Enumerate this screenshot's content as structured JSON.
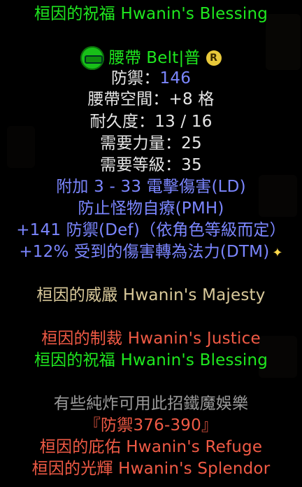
{
  "set_item_name": "桓因的祝福 Hwanin's Blessing",
  "item_type": {
    "label": "腰帶 Belt|普",
    "icon": "belt-icon",
    "rarity_badge": "R"
  },
  "stats": {
    "defense_label": "防禦：",
    "defense_value": "146",
    "belt_slots": "腰帶空間：+8 格",
    "durability": "耐久度：13 / 16",
    "req_str": "需要力量：25",
    "req_level": "需要等級：35"
  },
  "magic_props": [
    "附加 3 - 33 電擊傷害(LD)",
    "防止怪物自療(PMH)",
    "+141 防禦(Def)（依角色等級而定）",
    "+12% 受到的傷害轉為法力(DTM)"
  ],
  "set_name": "桓因的威嚴 Hwanin's Majesty",
  "set_items": [
    {
      "label": "桓因的制裁 Hwanin's Justice",
      "status": "missing"
    },
    {
      "label": "桓因的祝福 Hwanin's Blessing",
      "status": "equipped"
    }
  ],
  "rune_note": "有些純炸可用此招鐵魔娛樂",
  "defense_range": "『防禦376-390』",
  "extra_set_items": [
    {
      "label": "桓因的庇佑 Hwanin's Refuge",
      "status": "missing"
    },
    {
      "label": "桓因的光輝 Hwanin's Splendor",
      "status": "missing"
    }
  ],
  "colors": {
    "set_green": "#1fe81f",
    "magic_blue": "#7b86ff",
    "set_gold": "#d9c99a",
    "missing_red": "#f05a45",
    "note_grey": "#9a9a9a"
  }
}
